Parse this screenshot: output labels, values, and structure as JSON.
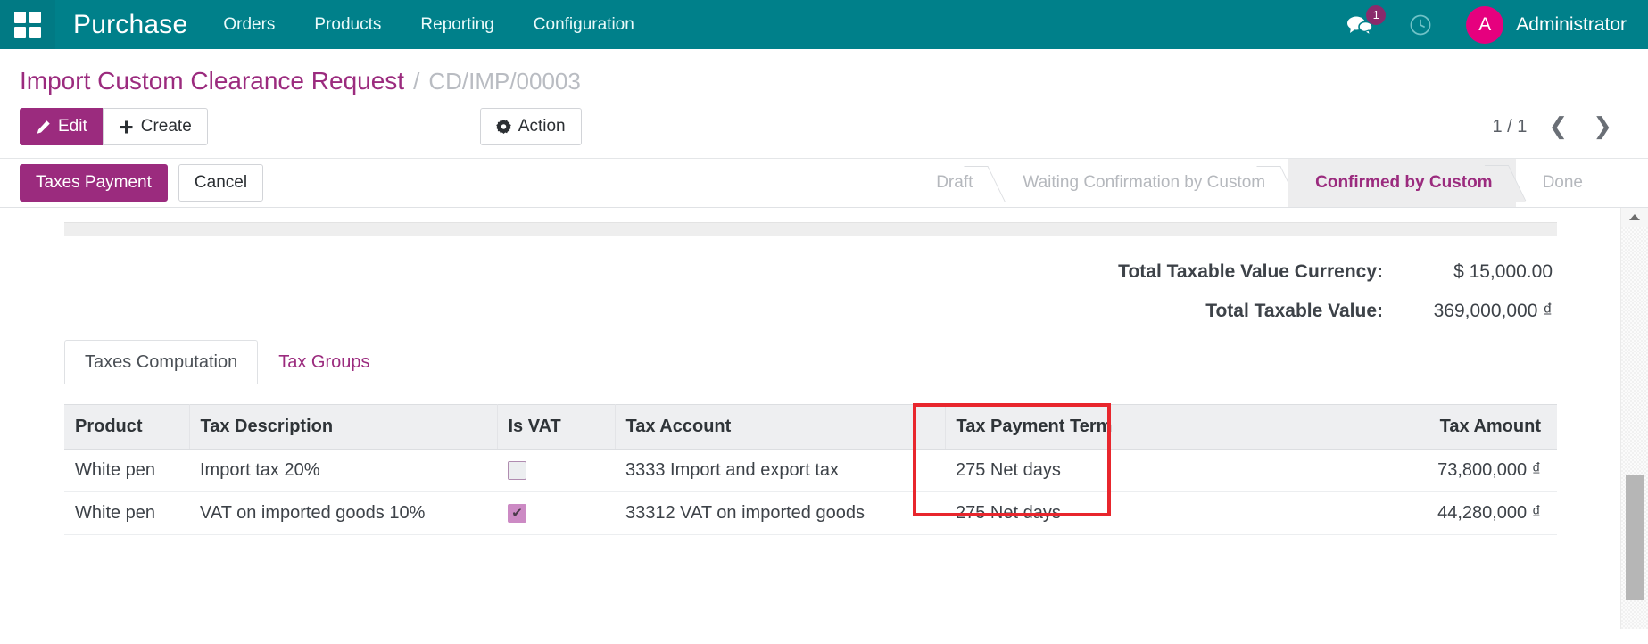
{
  "navbar": {
    "apps_icon": "apps-grid-icon",
    "brand": "Purchase",
    "menu": [
      {
        "label": "Orders"
      },
      {
        "label": "Products"
      },
      {
        "label": "Reporting"
      },
      {
        "label": "Configuration"
      }
    ],
    "messages_icon": "messages-icon",
    "messages_count": "1",
    "activity_icon": "clock-icon",
    "avatar_initial": "A",
    "user_name": "Administrator",
    "colors": {
      "navbar_bg": "#00808a",
      "accent_purple": "#9b2b7e",
      "avatar_pink": "#e6007e",
      "badge": "#8a2a6b"
    }
  },
  "breadcrumb": {
    "parent": "Import Custom Clearance Request",
    "separator": "/",
    "current": "CD/IMP/00003"
  },
  "controls": {
    "edit_label": "Edit",
    "edit_icon": "pencil-icon",
    "create_label": "Create",
    "create_icon": "plus-icon",
    "action_label": "Action",
    "action_icon": "gear-icon",
    "pager_text": "1 / 1",
    "prev_icon": "chevron-left-icon",
    "next_icon": "chevron-right-icon"
  },
  "statusbar": {
    "buttons": [
      {
        "label": "Taxes Payment",
        "primary": true
      },
      {
        "label": "Cancel",
        "primary": false
      }
    ],
    "stages": [
      {
        "label": "Draft",
        "active": false
      },
      {
        "label": "Waiting Confirmation by Custom",
        "active": false
      },
      {
        "label": "Confirmed by Custom",
        "active": true
      },
      {
        "label": "Done",
        "active": false
      }
    ]
  },
  "totals": [
    {
      "label": "Total Taxable Value Currency:",
      "value": "$ 15,000.00"
    },
    {
      "label": "Total Taxable Value:",
      "value": "369,000,000 ₫"
    }
  ],
  "tabs": [
    {
      "label": "Taxes Computation",
      "active": true
    },
    {
      "label": "Tax Groups",
      "active": false
    }
  ],
  "table": {
    "columns": [
      "Product",
      "Tax Description",
      "Is VAT",
      "Tax Account",
      "Tax Payment Term",
      "Tax Amount"
    ],
    "rows": [
      {
        "product": "White pen",
        "tax_description": "Import tax 20%",
        "is_vat": false,
        "tax_account": "3333 Import and export tax",
        "tax_payment_term": "275 Net days",
        "tax_amount": "73,800,000 ₫"
      },
      {
        "product": "White pen",
        "tax_description": "VAT on imported goods 10%",
        "is_vat": true,
        "tax_account": "33312 VAT on imported goods",
        "tax_payment_term": "275 Net days",
        "tax_amount": "44,280,000 ₫"
      }
    ],
    "checkbox_checked_glyph": "✔"
  },
  "annotation": {
    "color": "#e8262d",
    "target_column": "Tax Payment Term"
  },
  "scrollbar": {
    "up_arrow_icon": "triangle-up-icon"
  }
}
